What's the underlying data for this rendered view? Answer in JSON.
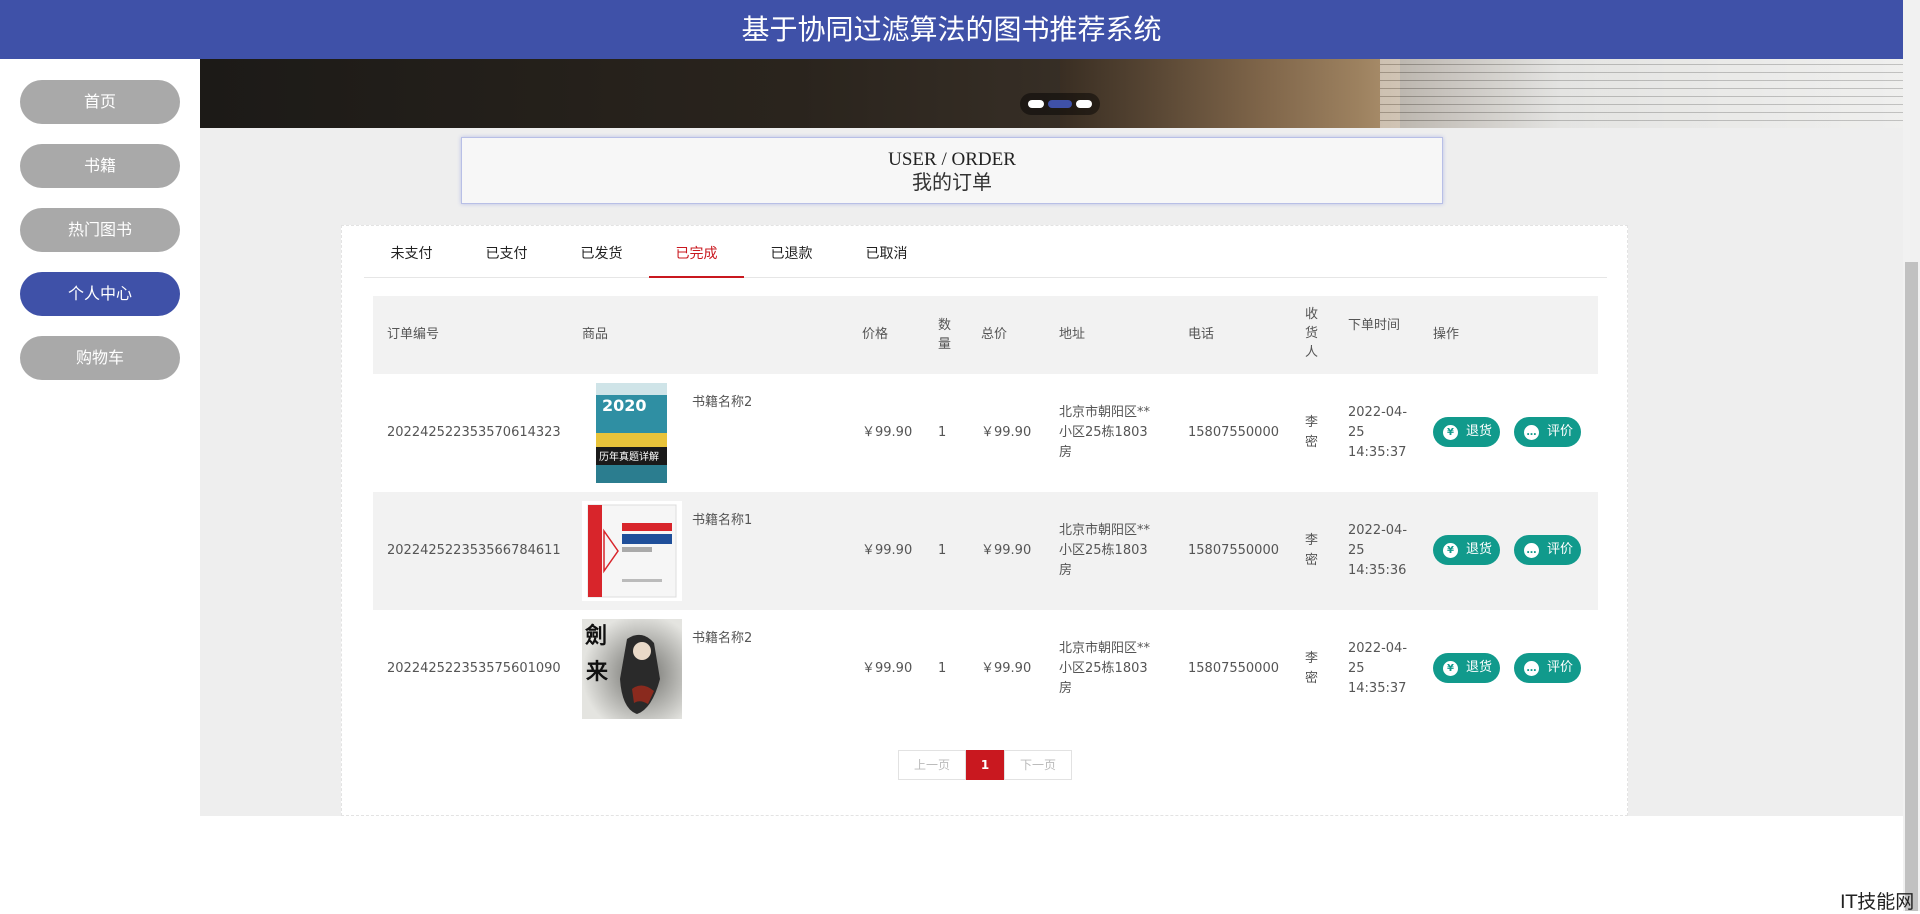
{
  "header": {
    "title": "基于协同过滤算法的图书推荐系统"
  },
  "sidebar": {
    "items": [
      {
        "label": "首页"
      },
      {
        "label": "书籍"
      },
      {
        "label": "热门图书"
      },
      {
        "label": "个人中心"
      },
      {
        "label": "购物车"
      }
    ],
    "active_index": 3
  },
  "page_title": {
    "en": "USER / ORDER",
    "cn": "我的订单"
  },
  "tabs": [
    {
      "label": "未支付"
    },
    {
      "label": "已支付"
    },
    {
      "label": "已发货"
    },
    {
      "label": "已完成"
    },
    {
      "label": "已退款"
    },
    {
      "label": "已取消"
    }
  ],
  "active_tab_index": 3,
  "table": {
    "headers": {
      "order_no": "订单编号",
      "product": "商品",
      "price": "价格",
      "qty": "数量",
      "total": "总价",
      "address": "地址",
      "phone": "电话",
      "receiver": "收货人",
      "time": "下单时间",
      "ops": "操作"
    },
    "rows": [
      {
        "order_no": "202242522353570614323",
        "book_name": "书籍名称2",
        "cover": "exam-book-cover",
        "price": "￥99.90",
        "qty": "1",
        "total": "￥99.90",
        "address": "北京市朝阳区**小区25栋1803房",
        "phone": "15807550000",
        "receiver": "李密",
        "time": "2022-04-25 14:35:37"
      },
      {
        "order_no": "202242522353566784611",
        "book_name": "书籍名称1",
        "cover": "red-book-cover",
        "price": "￥99.90",
        "qty": "1",
        "total": "￥99.90",
        "address": "北京市朝阳区**小区25栋1803房",
        "phone": "15807550000",
        "receiver": "李密",
        "time": "2022-04-25 14:35:36"
      },
      {
        "order_no": "202242522353575601090",
        "book_name": "书籍名称2",
        "cover": "swordsman-book-cover",
        "price": "￥99.90",
        "qty": "1",
        "total": "￥99.90",
        "address": "北京市朝阳区**小区25栋1803房",
        "phone": "15807550000",
        "receiver": "李密",
        "time": "2022-04-25 14:35:37"
      }
    ],
    "refund_label": "退货",
    "review_label": "评价"
  },
  "pager": {
    "prev": "上一页",
    "current": "1",
    "next": "下一页"
  },
  "watermark": "IT技能网",
  "colors": {
    "primary": "#3f51a8",
    "accent_red": "#c9181f",
    "teal": "#119a8c",
    "nav_gray": "#a9a9a9"
  }
}
